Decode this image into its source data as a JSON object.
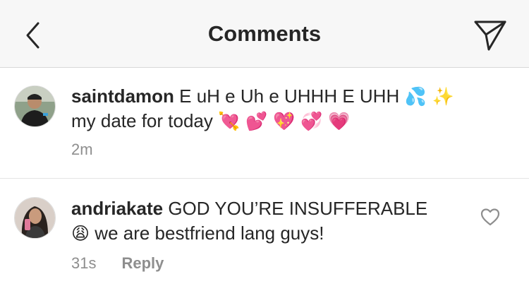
{
  "header": {
    "title": "Comments",
    "back_icon": "chevron-left-icon",
    "send_icon": "paper-plane-icon"
  },
  "comments": [
    {
      "username": "saintdamon",
      "text_line1": "E uH e Uh e UHHH E UHH",
      "emoji_line1": "💦 ✨",
      "text_line2": "my date for today",
      "emoji_line2": "💘 💕 💖 💞 💗",
      "time": "2m"
    },
    {
      "username": "andriakate",
      "text_line1": "GOD YOU’RE INSUFFERABLE",
      "emoji_line2": "😩",
      "text_line2": "we are bestfriend lang guys!",
      "time": "31s",
      "reply_label": "Reply",
      "like_icon": "heart-outline-icon"
    }
  ],
  "colors": {
    "header_bg": "#f7f7f7",
    "text": "#262626",
    "meta": "#8e8e8e"
  }
}
